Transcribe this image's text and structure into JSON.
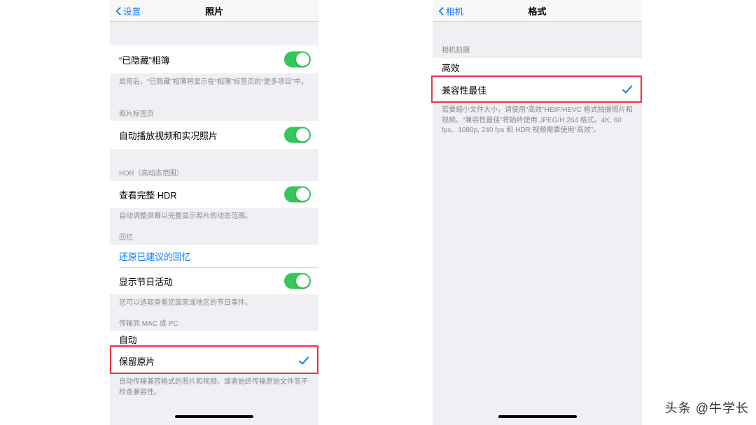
{
  "left_phone": {
    "nav": {
      "back_label": "设置",
      "back_icon": "chevron-left-icon",
      "title": "照片"
    },
    "rows": {
      "hidden_album": {
        "label": "“已隐藏”相簿",
        "toggle": "on"
      },
      "hidden_album_footer": "启用后，“已隐藏”相簿将显示在“相簿”标签页的“更多项目”中。",
      "photos_tab_header": "照片标签页",
      "autoplay": {
        "label": "自动播放视频和实况照片",
        "toggle": "on"
      },
      "hdr_header": "HDR（高动态范围）",
      "view_full_hdr": {
        "label": "查看完整 HDR",
        "toggle": "on"
      },
      "hdr_footer": "自动调整屏幕以完整显示照片的动态范围。",
      "memories_header": "回忆",
      "reset_memories": {
        "label": "还原已建议的回忆"
      },
      "show_holiday": {
        "label": "显示节日活动",
        "toggle": "on"
      },
      "holiday_footer": "您可以选取查看您国家或地区的节日事件。",
      "transfer_header": "传输到 MAC 或 PC",
      "automatic": {
        "label": "自动"
      },
      "keep_original": {
        "label": "保留原片",
        "checked": true
      },
      "keep_original_footer": "自动传输兼容格式的照片和视频，或者始终传输原始文件而不检查兼容性。"
    }
  },
  "right_phone": {
    "nav": {
      "back_label": "相机",
      "back_icon": "chevron-left-icon",
      "title": "格式"
    },
    "rows": {
      "camera_capture_header": "相机拍摄",
      "high_efficiency": {
        "label": "高效",
        "checked": false
      },
      "most_compatible": {
        "label": "兼容性最佳",
        "checked": true
      },
      "format_footer": "若要缩小文件大小，请使用“高效”HEIF/HEVC 格式拍摄照片和视频。“兼容性最佳”将始终使用 JPEG/H.264 格式。4K, 60 fps、1080p, 240 fps 和 HDR 视频需要使用“高效”。"
    }
  },
  "watermark": "头条 @牛学长",
  "colors": {
    "accent_blue": "#0a7aff",
    "toggle_green": "#34c759",
    "highlight_red": "#e8353f",
    "group_bg": "#efeff4"
  }
}
